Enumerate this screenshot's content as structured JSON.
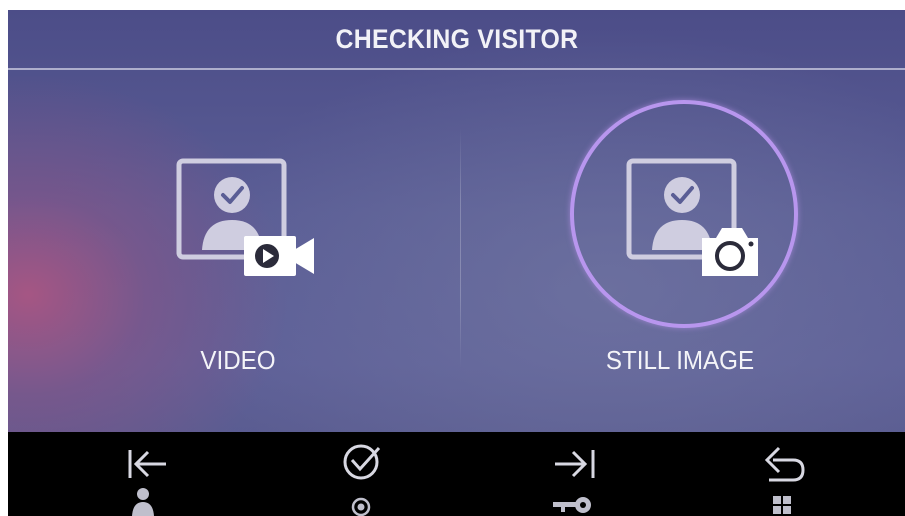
{
  "header": {
    "title": "CHECKING VISITOR"
  },
  "options": [
    {
      "label": "VIDEO",
      "icon": "visitor-video-icon",
      "selected": false
    },
    {
      "label": "STILL IMAGE",
      "icon": "visitor-camera-icon",
      "selected": true
    }
  ],
  "nav": [
    {
      "icon": "first-arrow-icon",
      "sub_icon": "person-icon"
    },
    {
      "icon": "check-circle-icon",
      "sub_icon": "record-dot-icon"
    },
    {
      "icon": "last-arrow-icon",
      "sub_icon": "key-icon"
    },
    {
      "icon": "back-arrow-icon",
      "sub_icon": "grid-icon"
    }
  ],
  "colors": {
    "accent_ring": "#b896ee",
    "text": "#f4f4f8",
    "bar": "#000000",
    "background": "#5a5d95"
  }
}
